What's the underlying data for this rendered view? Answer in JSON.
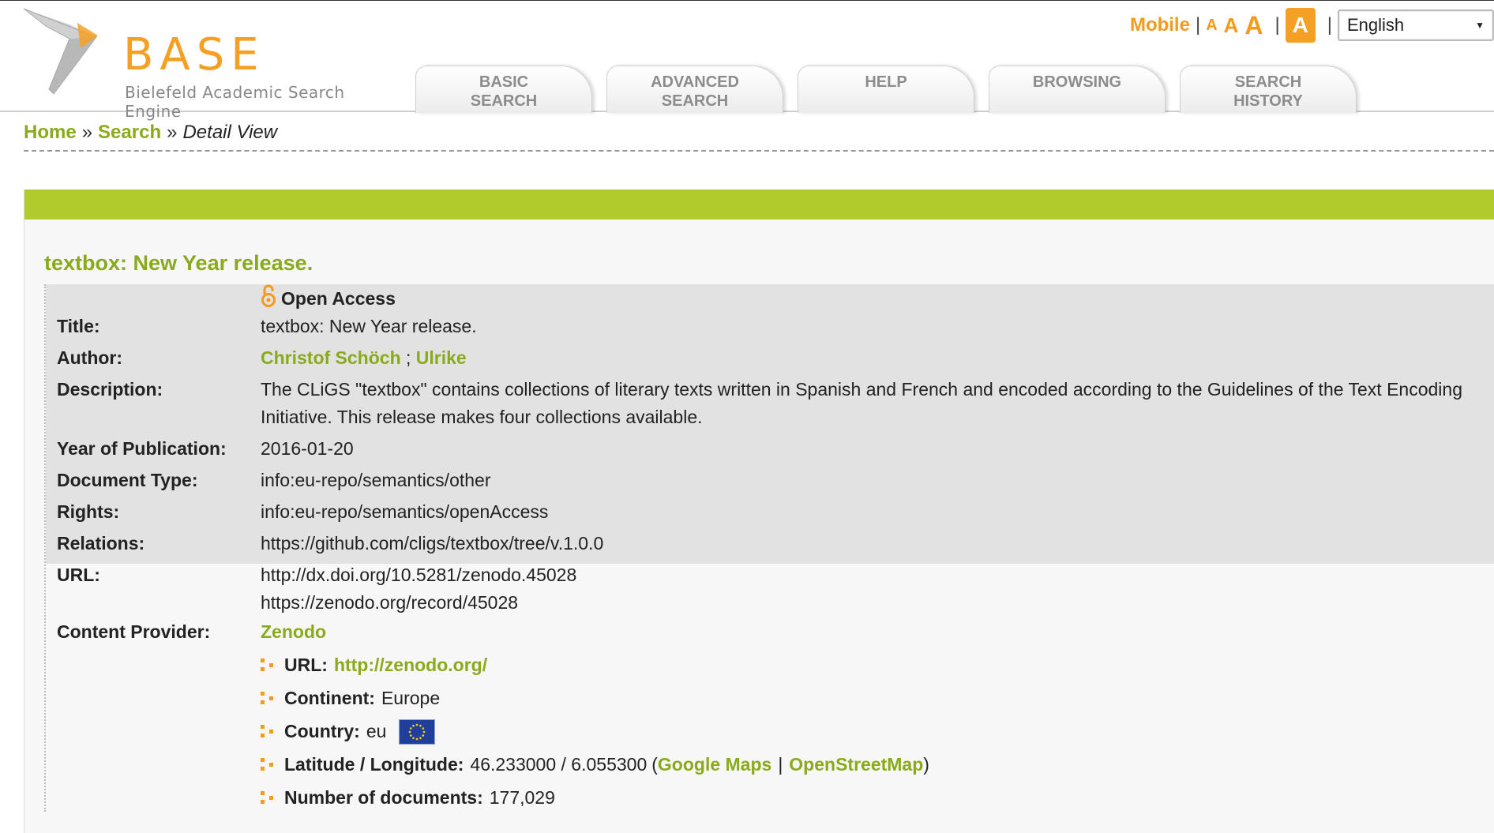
{
  "logo": {
    "wordmark": "BASE",
    "subtitle": "Bielefeld Academic Search Engine"
  },
  "topbar": {
    "mobile": "Mobile",
    "separator": "|",
    "font_small": "A",
    "font_medium": "A",
    "font_large": "A",
    "font_active": "A",
    "language": "English"
  },
  "tabs": [
    {
      "label_line1": "BASIC",
      "label_line2": "SEARCH"
    },
    {
      "label_line1": "ADVANCED",
      "label_line2": "SEARCH"
    },
    {
      "label_line1": "HELP",
      "label_line2": ""
    },
    {
      "label_line1": "BROWSING",
      "label_line2": ""
    },
    {
      "label_line1": "SEARCH",
      "label_line2": "HISTORY"
    }
  ],
  "breadcrumb": {
    "home": "Home",
    "search": "Search",
    "current": "Detail View",
    "separator": "»"
  },
  "record": {
    "heading": "textbox: New Year release.",
    "access": "Open Access",
    "fields": {
      "title_label": "Title:",
      "title": "textbox: New Year release.",
      "author_label": "Author:",
      "author1": "Christof Schöch",
      "author_sep": ";",
      "author2": "Ulrike",
      "description_label": "Description:",
      "description": "The CLiGS \"textbox\" contains collections of literary texts written in Spanish and French and encoded according to the Guidelines of the Text Encoding Initiative. This release makes four collections available.",
      "year_label": "Year of Publication:",
      "year": "2016-01-20",
      "doctype_label": "Document Type:",
      "doctype": "info:eu-repo/semantics/other",
      "rights_label": "Rights:",
      "rights": "info:eu-repo/semantics/openAccess",
      "relations_label": "Relations:",
      "relations": "https://github.com/cligs/textbox/tree/v.1.0.0",
      "url_label": "URL:",
      "url1": "http://dx.doi.org/10.5281/zenodo.45028",
      "url2": "https://zenodo.org/record/45028",
      "provider_label": "Content Provider:",
      "provider": "Zenodo"
    },
    "provider_details": {
      "url_label": "URL:",
      "url": "http://zenodo.org/",
      "continent_label": "Continent:",
      "continent": "Europe",
      "country_label": "Country:",
      "country": "eu",
      "latlon_label": "Latitude / Longitude:",
      "latlon": "46.233000 / 6.055300",
      "open_paren": "(",
      "google_maps": "Google Maps",
      "map_sep": "|",
      "osm": "OpenStreetMap",
      "close_paren": ")",
      "docs_label": "Number of documents:",
      "docs": "177,029"
    }
  },
  "colors": {
    "accent_green": "#8aaa1c",
    "bar_green": "#b1ca2c",
    "accent_orange": "#f49b1a"
  }
}
